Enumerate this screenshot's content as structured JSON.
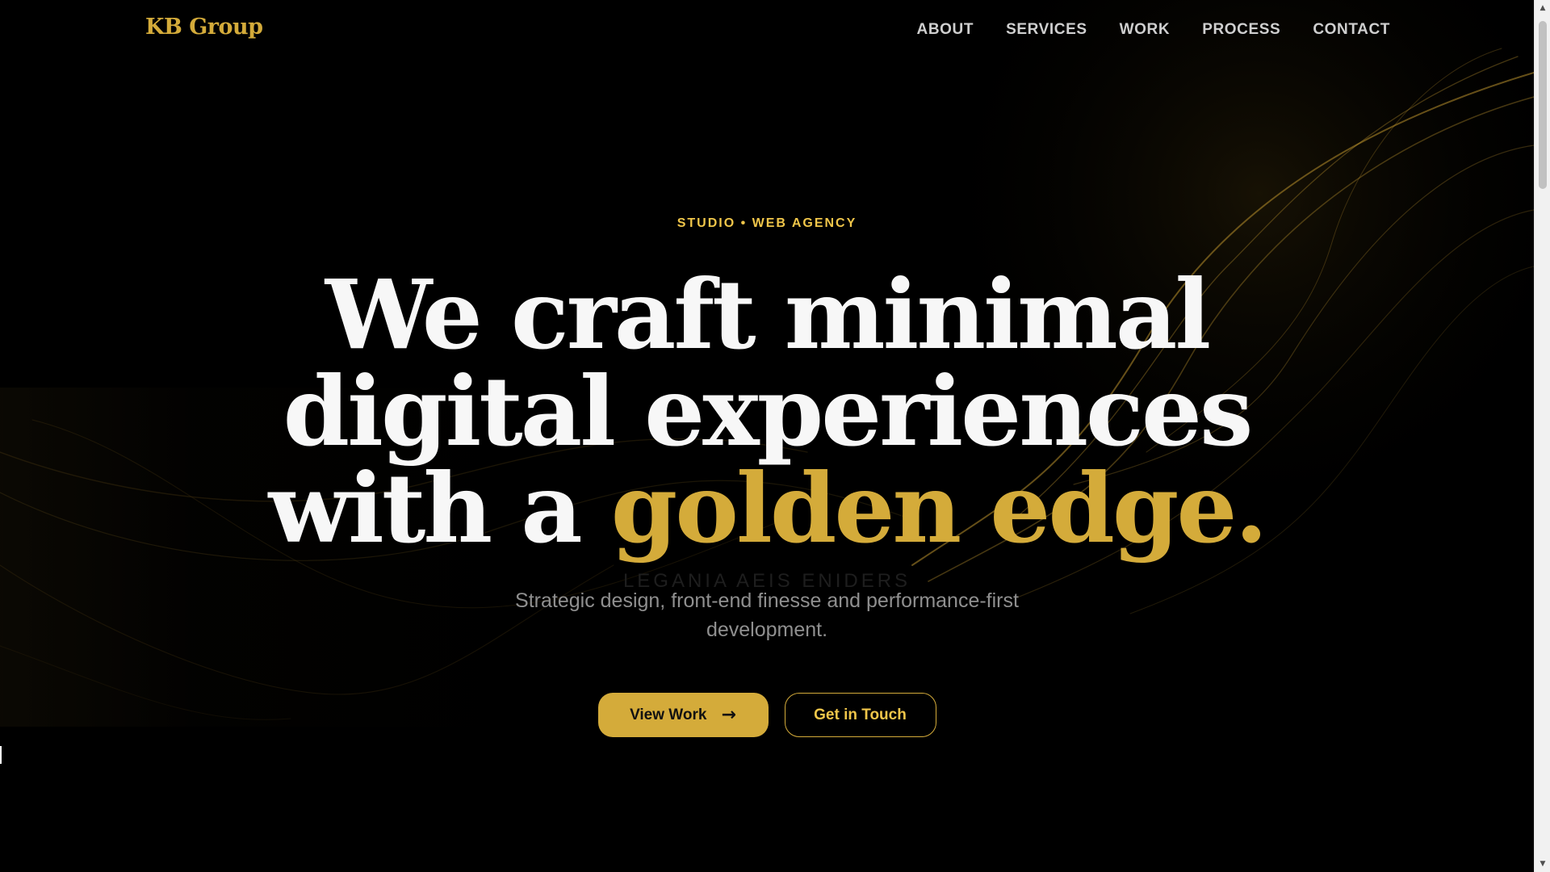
{
  "header": {
    "logo": "KB Group",
    "nav": [
      "ABOUT",
      "SERVICES",
      "WORK",
      "PROCESS",
      "CONTACT"
    ]
  },
  "hero": {
    "eyebrow": "STUDIO • WEB AGENCY",
    "headline_line1": "We craft minimal",
    "headline_line2": "digital experiences",
    "headline_line3_prefix": "with a",
    "headline_line3_accent": "golden edge.",
    "ghost_text": "LEGANIA AEIS ENIDERS",
    "subtext": "Strategic design, front-end finesse and performance-first development.",
    "primary_cta": "View Work",
    "primary_cta_icon": "arrow-right-icon",
    "secondary_cta": "Get in Touch"
  },
  "colors": {
    "background": "#000000",
    "gold": "#d4ab3a",
    "gold_light": "#f0c64a",
    "headline": "#f7f7f7",
    "nav_text": "#cfcfcf",
    "subtext": "#8f8f8f"
  }
}
